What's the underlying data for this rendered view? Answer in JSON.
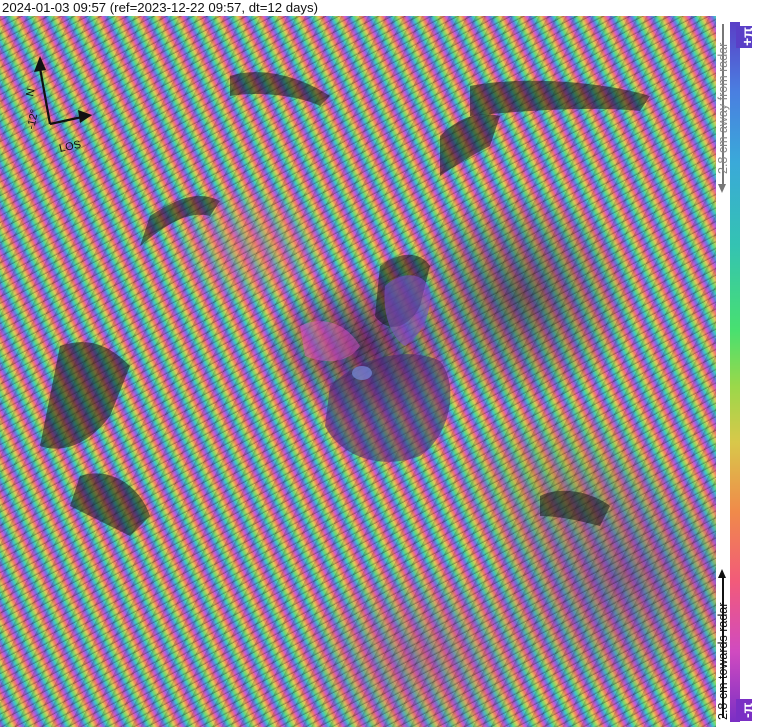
{
  "title": "2024-01-03 09:57 (ref=2023-12-22 09:57, dt=12 days)",
  "compass": {
    "north_label": "N",
    "heading_label": "-12°",
    "los_label": "LOS",
    "north_icon": "north-arrow-icon",
    "los_icon": "los-arrow-icon"
  },
  "colorbar": {
    "top_symbol": "+π",
    "bottom_symbol": "-π",
    "away_label": "2.8 cm away from radar",
    "towards_label": "2.8 cm towards radar",
    "range": [
      "-π",
      "+π"
    ],
    "colors": [
      "#5a3fc7",
      "#4a7fe0",
      "#34c3b2",
      "#48e070",
      "#d8c84a",
      "#f08a4a",
      "#f25a7a",
      "#d04ac0",
      "#7a2fc4"
    ]
  }
}
